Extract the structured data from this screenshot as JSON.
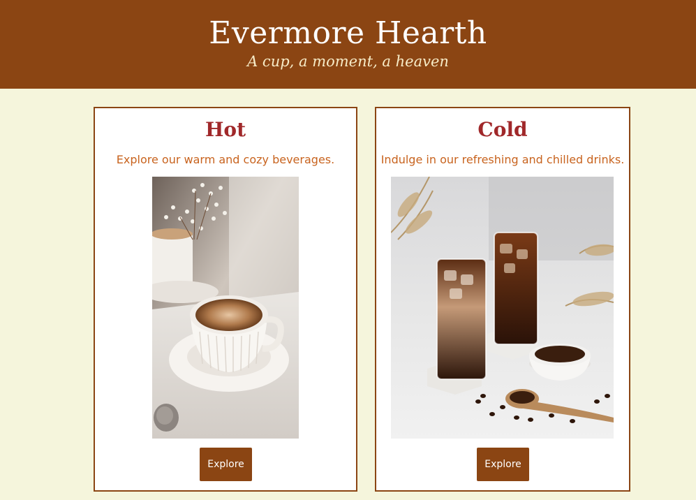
{
  "header": {
    "title": "Evermore Hearth",
    "tagline": "A cup, a moment, a heaven"
  },
  "cards": [
    {
      "title": "Hot",
      "description": "Explore our warm and cozy beverages.",
      "image_alt": "hot-coffee-cup-photo",
      "button_label": "Explore"
    },
    {
      "title": "Cold",
      "description": "Indulge in our refreshing and chilled drinks.",
      "image_alt": "iced-coffee-glasses-photo",
      "button_label": "Explore"
    }
  ],
  "colors": {
    "header_bg": "#8b4513",
    "page_bg": "#f5f5dc",
    "card_title": "#a0282a",
    "card_desc": "#c8631e",
    "button_bg": "#8b4513"
  }
}
